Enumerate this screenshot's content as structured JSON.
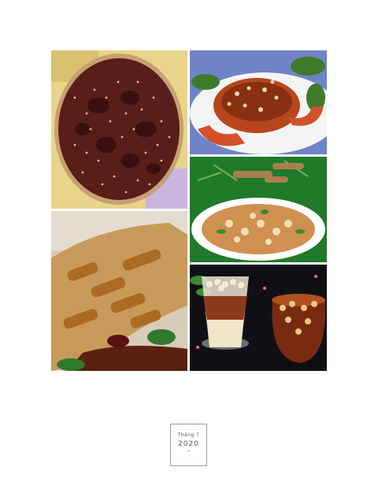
{
  "collage": {
    "photos": [
      {
        "name": "tamarind-sesame-sauce-photo"
      },
      {
        "name": "tamarind-crab-photo"
      },
      {
        "name": "tamarind-snail-dish-photo"
      },
      {
        "name": "glazed-squid-photo"
      },
      {
        "name": "tamarind-drinks-photo"
      }
    ]
  },
  "stamp": {
    "line1": "Tháng 7",
    "line2": "2020",
    "line3": "–"
  }
}
